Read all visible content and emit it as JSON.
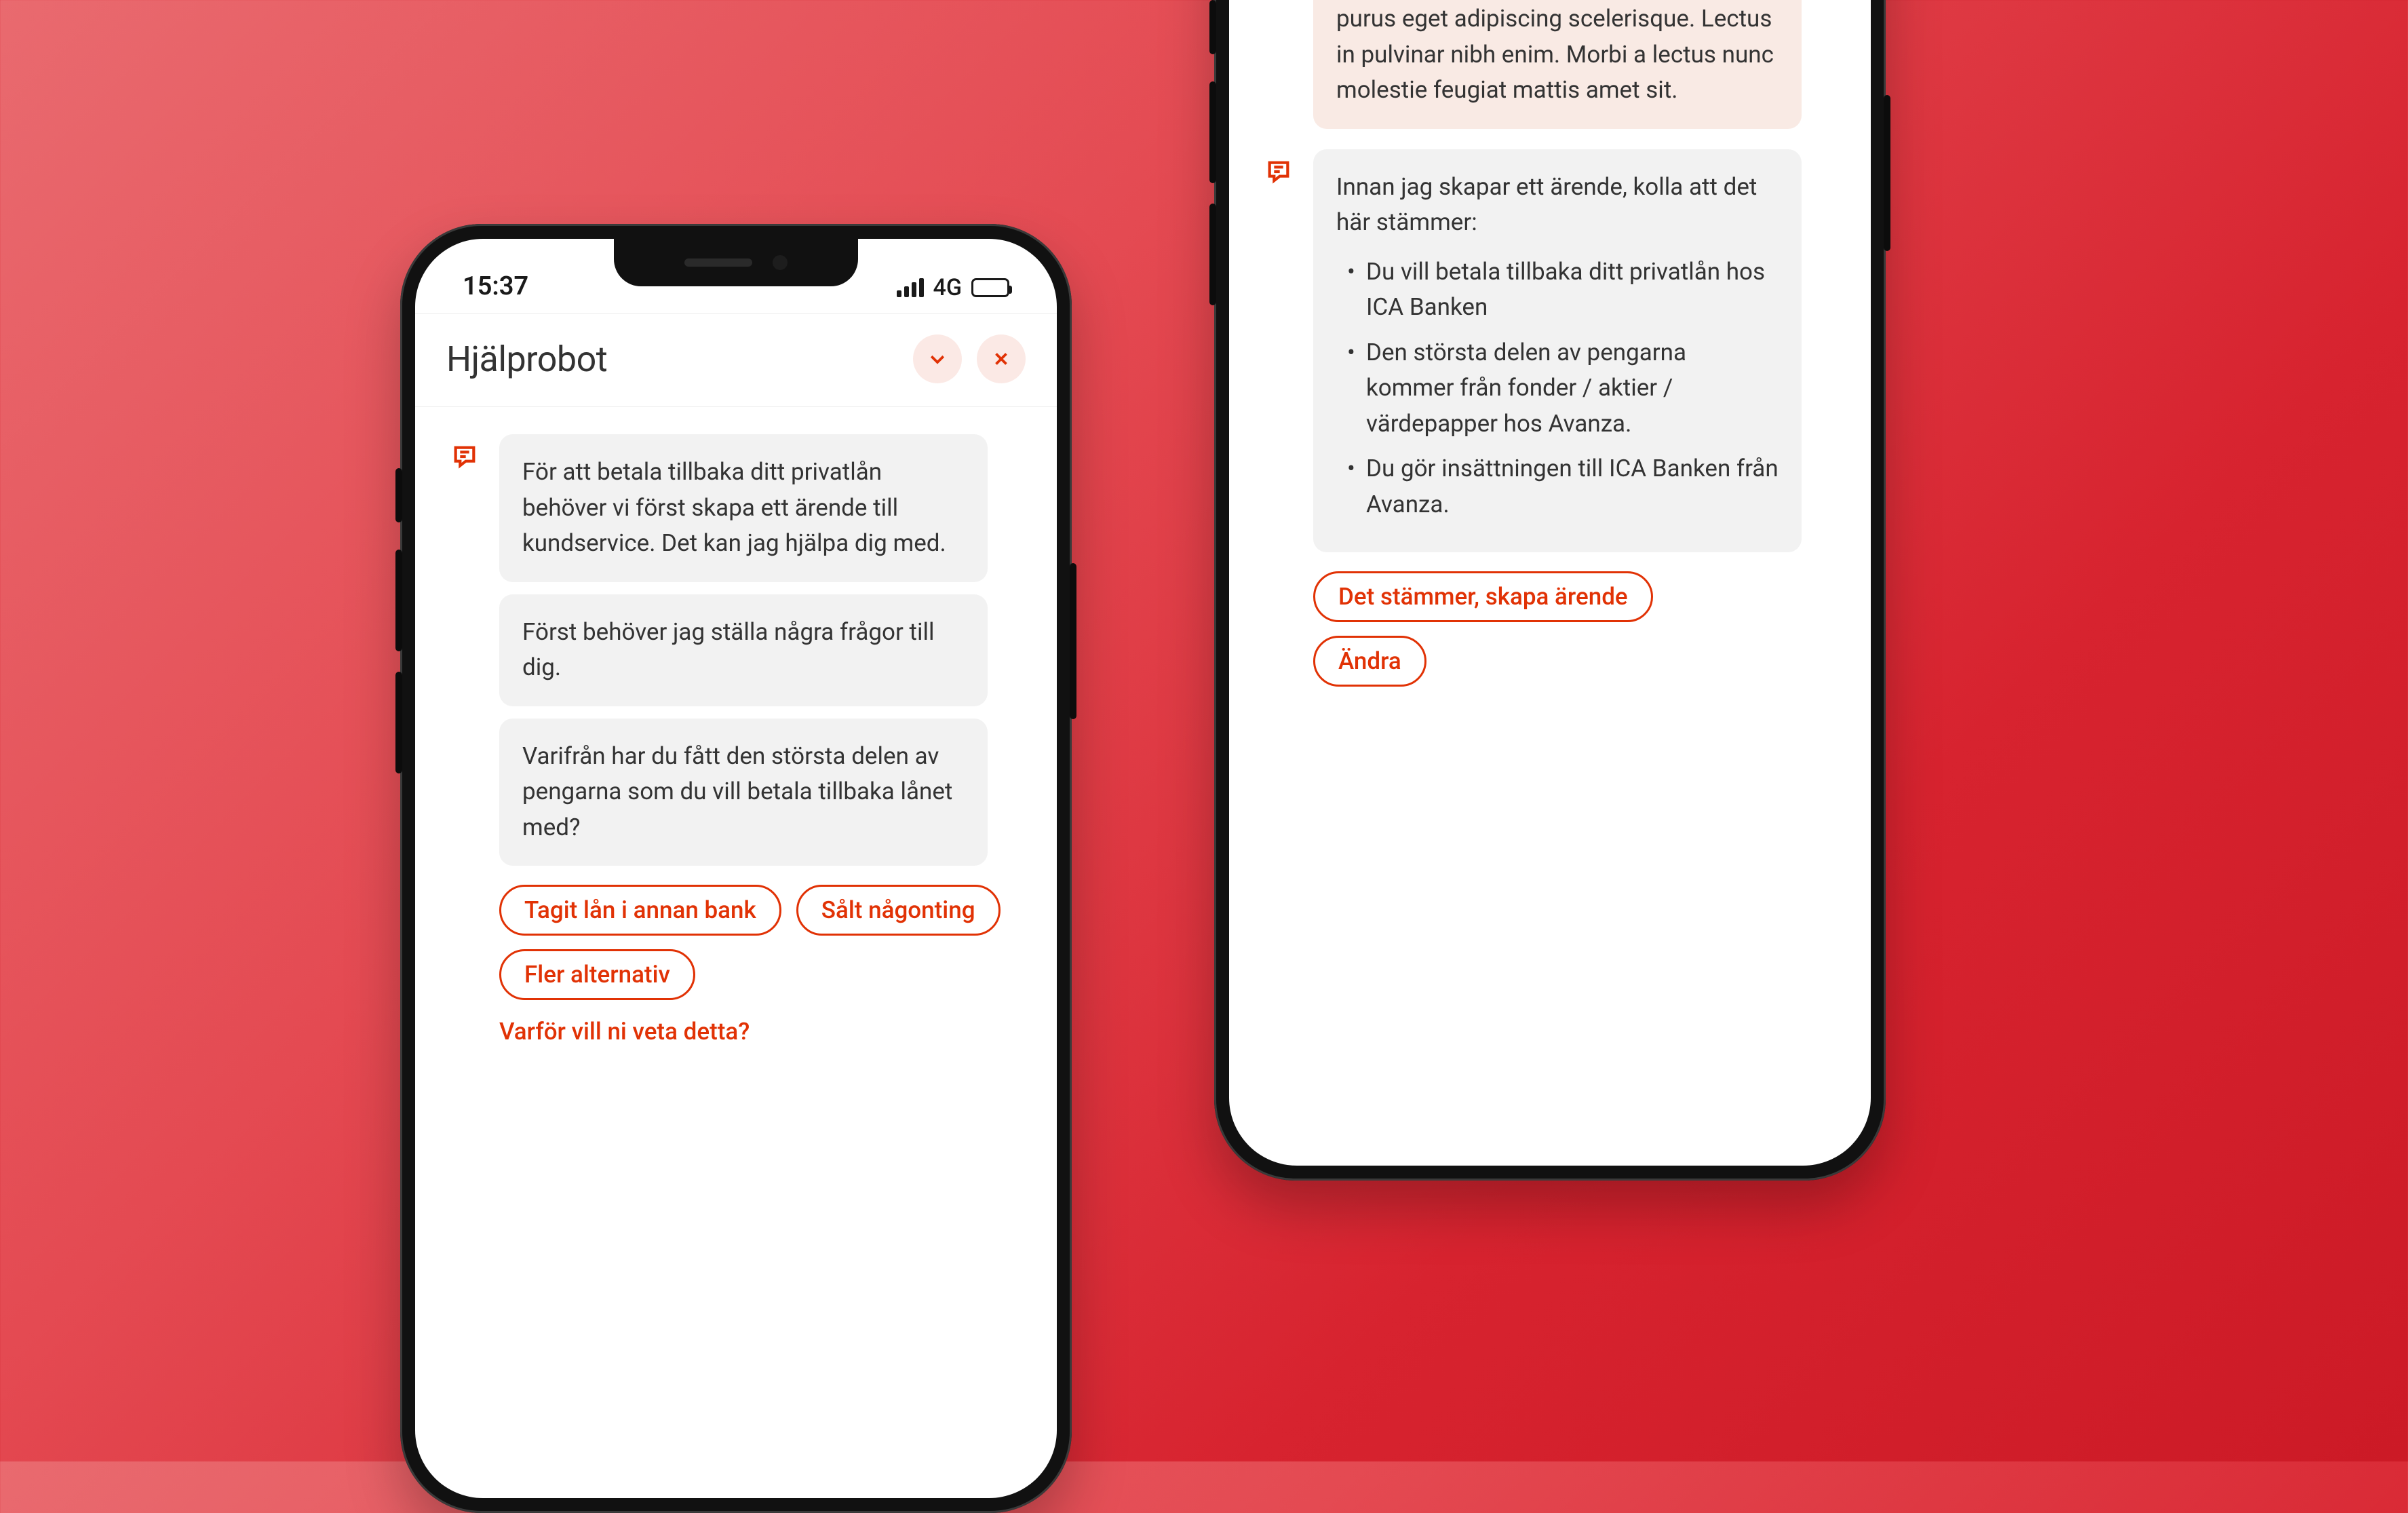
{
  "colors": {
    "accent": "#E13205",
    "chip_border": "#E13205",
    "bubble_gray": "#f2f2f2",
    "bubble_peach": "#f9eae4"
  },
  "status": {
    "time": "15:37",
    "network": "4G"
  },
  "header": {
    "title": "Hjälprobot"
  },
  "icons": {
    "bot": "chat-bubble-icon",
    "minimize": "chevron-down-icon",
    "close": "close-icon"
  },
  "phone1": {
    "messages": [
      "För att betala tillbaka ditt privatlån behöver vi först skapa ett ärende till kundservice. Det kan jag hjälpa dig med.",
      "Först behöver jag ställa några frågor till dig.",
      "Varifrån har du fått den största delen av pengarna som du vill betala tillbaka lånet med?"
    ],
    "chips": [
      "Tagit lån i annan bank",
      "Sålt någonting",
      "Fler alternativ"
    ],
    "link": "Varför vill ni veta detta?"
  },
  "phone2": {
    "peach_fragment": "purus eget adipiscing scelerisque. Lectus in pulvinar nibh enim. Morbi a lectus nunc molestie feugiat mattis amet sit.",
    "confirm_intro": "Innan jag skapar ett ärende, kolla att det här stämmer:",
    "confirm_items": [
      "Du vill betala tillbaka ditt privatlån hos ICA Banken",
      "Den största delen av pengarna kommer från fonder / aktier / värdepapper hos Avanza.",
      "Du gör insättningen till ICA Banken från Avanza."
    ],
    "chips": [
      "Det stämmer, skapa ärende",
      "Ändra"
    ]
  }
}
